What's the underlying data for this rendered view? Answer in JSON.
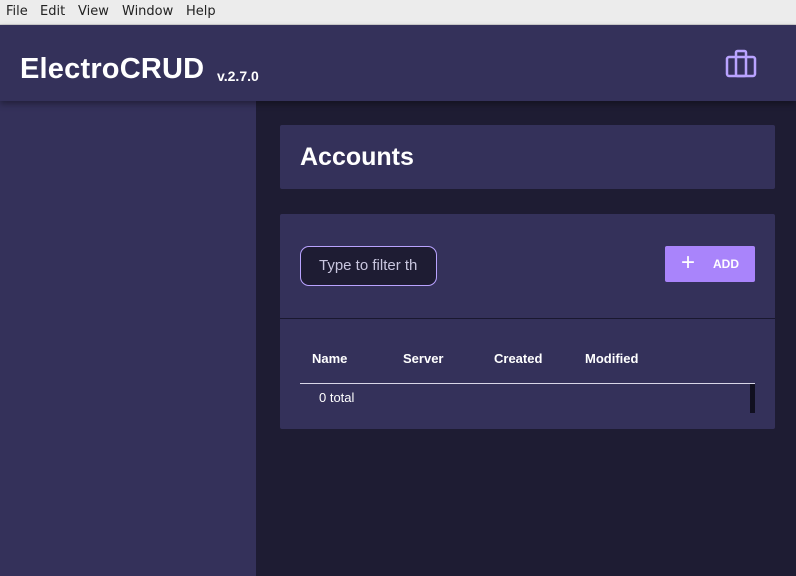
{
  "menu": [
    "File",
    "Edit",
    "View",
    "Window",
    "Help"
  ],
  "app": {
    "title": "ElectroCRUD",
    "version": "v.2.7.0"
  },
  "icons": {
    "workspace": "briefcase-icon",
    "add": "plus-icon"
  },
  "colors": {
    "appbar": "#34315a",
    "background": "#1e1c33",
    "accent": "#a984fb",
    "filter_border": "#b9a3ff"
  },
  "page": {
    "title": "Accounts"
  },
  "toolbar": {
    "filter_placeholder": "Type to filter th",
    "add_label": "ADD"
  },
  "table": {
    "columns": [
      "Name",
      "Server",
      "Created",
      "Modified"
    ],
    "footer": "0 total"
  }
}
